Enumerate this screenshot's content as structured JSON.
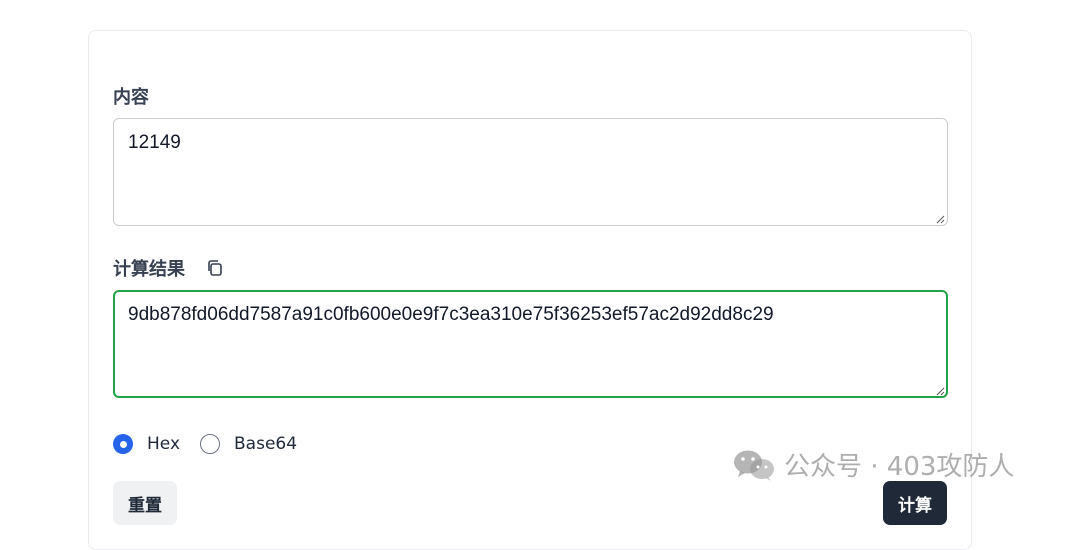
{
  "form": {
    "content_label": "内容",
    "content_value": "12149",
    "result_label": "计算结果",
    "result_value": "9db878fd06dd7587a91c0fb600e0e9f7c3ea310e75f36253ef57ac2d92dd8c29",
    "encoding_options": [
      {
        "label": "Hex",
        "selected": true
      },
      {
        "label": "Base64",
        "selected": false
      }
    ],
    "reset_label": "重置",
    "calc_label": "计算"
  },
  "watermark": {
    "text": "公众号 · 403攻防人",
    "icon": "wechat-logo"
  },
  "colors": {
    "result_border": "#22a347",
    "radio_selected": "#2563eb",
    "primary_button": "#1f2937"
  }
}
